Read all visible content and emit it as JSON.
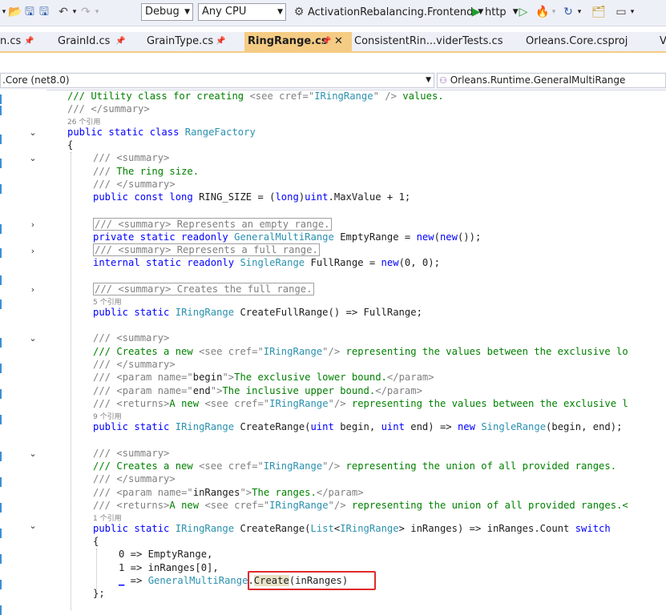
{
  "toolbar": {
    "config": "Debug",
    "platform": "Any CPU",
    "startup_project": "ActivationRebalancing.Frontend",
    "run_target": "http"
  },
  "tabs": [
    {
      "label": "n.cs"
    },
    {
      "label": "GrainId.cs"
    },
    {
      "label": "GrainType.cs"
    },
    {
      "label": "RingRange.cs",
      "active": true
    },
    {
      "label": "ConsistentRin...viderTests.cs"
    },
    {
      "label": "Orleans.Core.csproj"
    },
    {
      "label": "V"
    }
  ],
  "navbar": {
    "project": ".Core (net8.0)",
    "type": "Orleans.Runtime.GeneralMultiRange"
  },
  "code": {
    "l1": [
      "/// Utility class for creating ",
      "<see cref=\"",
      "IRingRange",
      "\" />",
      " values."
    ],
    "l2": "/// </summary>",
    "lens1": "26 个引用",
    "l3": [
      "public static class ",
      "RangeFactory"
    ],
    "l4": "{",
    "l5": "/// <summary>",
    "l6": "/// The ring size.",
    "l7": "/// </summary>",
    "l8": [
      "public const long ",
      "RING_SIZE = (",
      "long",
      ")",
      "uint",
      ".MaxValue + 1;"
    ],
    "c1": "/// <summary> Represents an empty range.",
    "l9": [
      "private static readonly ",
      "GeneralMultiRange",
      " EmptyRange = ",
      "new",
      "(",
      "new",
      "());"
    ],
    "c2": "/// <summary> Represents a full range.",
    "l10": [
      "internal static readonly ",
      "SingleRange",
      " FullRange = ",
      "new",
      "(0, 0);"
    ],
    "c3": "/// <summary> Creates the full range.",
    "lens2": "5 个引用",
    "l11": [
      "public static ",
      "IRingRange",
      " CreateFullRange() => FullRange;"
    ],
    "l12": "/// <summary>",
    "l13": [
      "/// Creates a new ",
      "<see cref=\"",
      "IRingRange",
      "\"/>",
      " representing the values between the exclusive lo"
    ],
    "l14": "/// </summary>",
    "l15": [
      "/// ",
      "<param name=\"",
      "begin",
      "\">",
      "The exclusive lower bound.",
      "</param>"
    ],
    "l16": [
      "/// ",
      "<param name=\"",
      "end",
      "\">",
      "The inclusive upper bound.",
      "</param>"
    ],
    "l17": [
      "/// ",
      "<returns>",
      "A new ",
      "<see cref=\"",
      "IRingRange",
      "\"/>",
      " representing the values between the exclusive l"
    ],
    "lens3": "9 个引用",
    "l18": [
      "public static ",
      "IRingRange",
      " CreateRange(",
      "uint",
      " begin, ",
      "uint",
      " end) => ",
      "new",
      " ",
      "SingleRange",
      "(begin, end);"
    ],
    "l19": "/// <summary>",
    "l20": [
      "/// Creates a new ",
      "<see cref=\"",
      "IRingRange",
      "\"/>",
      " representing the union of all provided ranges."
    ],
    "l21": "/// </summary>",
    "l22": [
      "/// ",
      "<param name=\"",
      "inRanges",
      "\">",
      "The ranges.",
      "</param>"
    ],
    "l23": [
      "/// ",
      "<returns>",
      "A new ",
      "<see cref=\"",
      "IRingRange",
      "\"/>",
      " representing the union of all provided ranges.<"
    ],
    "lens4": "1 个引用",
    "l24": [
      "public static ",
      "IRingRange",
      " CreateRange(",
      "List",
      "<",
      "IRingRange",
      "> inRanges) => inRanges.Count ",
      "switch"
    ],
    "l25": "{",
    "l26": "0 => EmptyRange,",
    "l27": "1 => inRanges[0],",
    "l28": [
      "_",
      " => ",
      "GeneralMultiRange",
      ".",
      "Create",
      "(inRanges)"
    ],
    "l29": "};"
  },
  "colors": {
    "accent_tab": "#f5cc84",
    "highlight_box": "#e02a2a",
    "comment": "#008000",
    "keyword": "#0000ff",
    "type": "#2b91af"
  }
}
